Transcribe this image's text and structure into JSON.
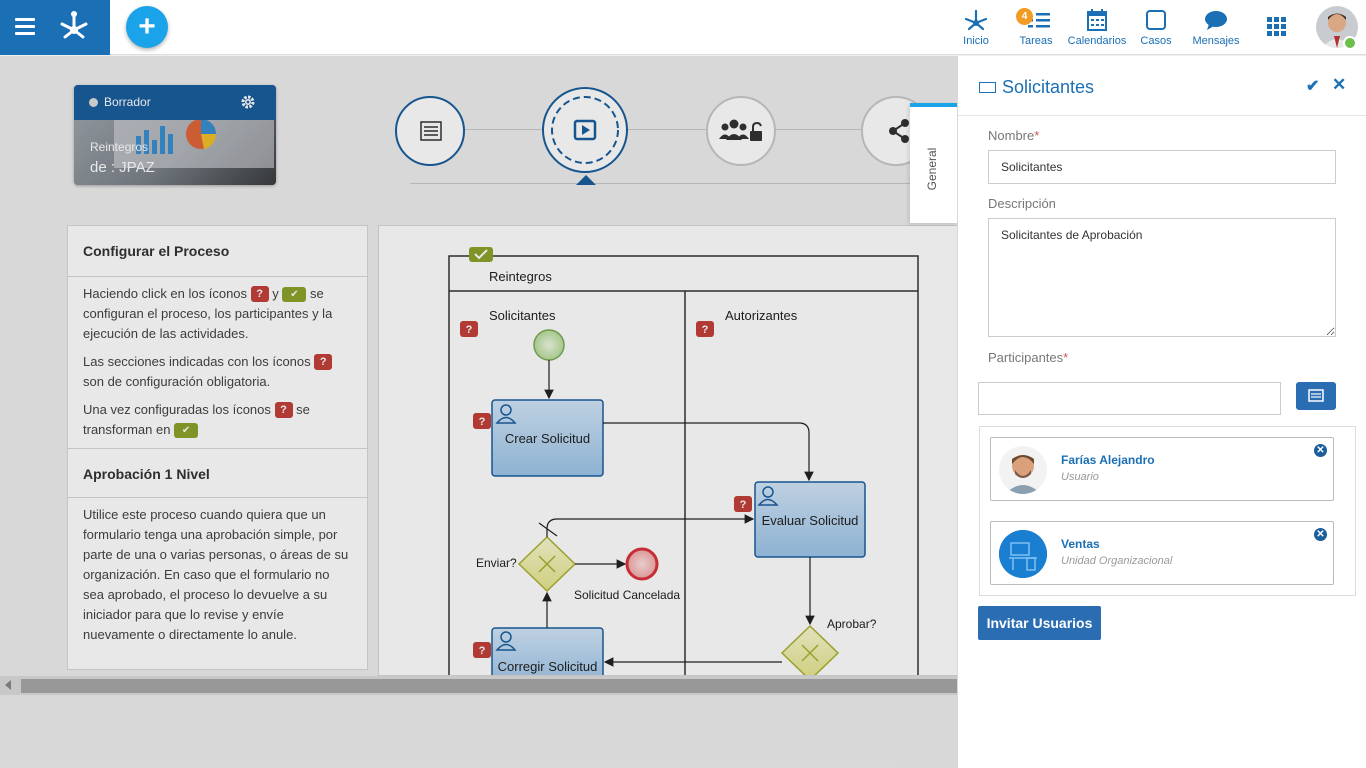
{
  "nav": {
    "items": [
      {
        "label": "Inicio",
        "icon": "home-network-icon"
      },
      {
        "label": "Tareas",
        "icon": "tasks-icon",
        "badge": "4"
      },
      {
        "label": "Calendarios",
        "icon": "calendar-icon"
      },
      {
        "label": "Casos",
        "icon": "cases-icon"
      },
      {
        "label": "Mensajes",
        "icon": "chat-icon"
      }
    ]
  },
  "card": {
    "status": "Borrador",
    "title_line1": "Reintegros",
    "title_line2": "de : JPAZ"
  },
  "left_panel": {
    "section1_title": "Configurar el Proceso",
    "p1_a": "Haciendo click en los íconos",
    "p1_y": "y",
    "p1_b": "se configuran el proceso, los participantes y la ejecución de las actividades.",
    "p2_a": "Las secciones indicadas con los íconos",
    "p2_b": "son de configuración obligatoria.",
    "p3_a": "Una vez configuradas los íconos",
    "p3_b": "se transforman en",
    "section2_title": "Aprobación 1 Nivel",
    "section2_text": "Utilice este proceso cuando quiera que un formulario tenga una aprobación simple, por parte de una o varias personas, o áreas de su organización. En caso que el formulario no sea aprobado, el proceso lo devuelve a su iniciador para que lo revise y envíe nuevamente o directamente lo anule."
  },
  "diagram": {
    "pool": "Reintegros",
    "lane1": "Solicitantes",
    "lane2": "Autorizantes",
    "task_crear": "Crear Solicitud",
    "task_evaluar": "Evaluar Solicitud",
    "task_corregir": "Corregir Solicitud",
    "gateway_enviar": "Enviar?",
    "gateway_aprobar": "Aprobar?",
    "end_event": "Solicitud Cancelada"
  },
  "general_tab": "General",
  "side_panel": {
    "title": "Solicitantes",
    "nombre_label": "Nombre",
    "nombre_value": "Solicitantes",
    "descripcion_label": "Descripción",
    "descripcion_value": "Solicitantes de Aprobación",
    "participantes_label": "Participantes",
    "participants": [
      {
        "name": "Farías Alejandro",
        "type": "Usuario"
      },
      {
        "name": "Ventas",
        "type": "Unidad Organizacional"
      }
    ],
    "invite_label": "Invitar Usuarios"
  },
  "colors": {
    "brand": "#1a6fb5",
    "accent": "#1aa3e8",
    "required": "#c4403a",
    "configured": "#8ca32a"
  }
}
